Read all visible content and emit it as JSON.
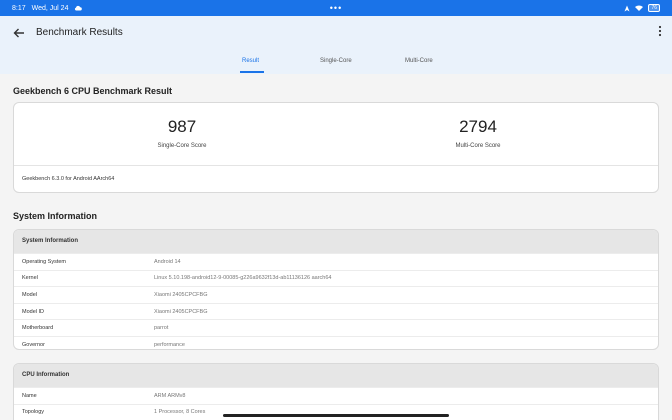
{
  "status": {
    "time": "8:17",
    "date": "Wed, Jul 24",
    "dots": "•••",
    "battery": "76"
  },
  "header": {
    "title": "Benchmark Results"
  },
  "tabs": [
    {
      "label": "Result"
    },
    {
      "label": "Single-Core"
    },
    {
      "label": "Multi-Core"
    }
  ],
  "benchmark": {
    "title": "Geekbench 6 CPU Benchmark Result",
    "single_score": "987",
    "single_label": "Single-Core Score",
    "multi_score": "2794",
    "multi_label": "Multi-Core Score",
    "version": "Geekbench 6.3.0 for Android AArch64"
  },
  "system_section": {
    "title": "System Information",
    "card_header": "System Information",
    "rows": [
      {
        "key": "Operating System",
        "value": "Android 14"
      },
      {
        "key": "Kernel",
        "value": "Linux 5.10.198-android12-9-00085-g226a9632f13d-ab11136126 aarch64"
      },
      {
        "key": "Model",
        "value": "Xiaomi 2405CPCFBG"
      },
      {
        "key": "Model ID",
        "value": "Xiaomi 2405CPCFBG"
      },
      {
        "key": "Motherboard",
        "value": "parrot"
      },
      {
        "key": "Governor",
        "value": "performance"
      }
    ]
  },
  "cpu_section": {
    "card_header": "CPU Information",
    "rows": [
      {
        "key": "Name",
        "value": "ARM ARMv8"
      },
      {
        "key": "Topology",
        "value": "1 Processor, 8 Cores"
      }
    ]
  }
}
